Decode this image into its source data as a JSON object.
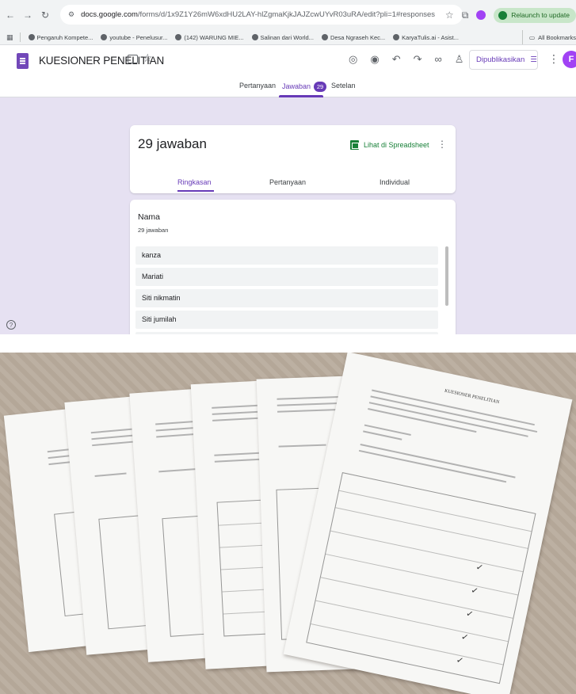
{
  "browser": {
    "url_host": "docs.google.com",
    "url_path": "/forms/d/1x9Z1Y26mW6xdHU2LAY-hlZgmaKjkJAJZcwUYvR03uRA/edit?pli=1#responses",
    "relaunch_label": "Relaunch to update",
    "bookmarks": [
      "Pengaruh Kompete...",
      "youtube - Penelusur...",
      "(142) WARUNG MIE...",
      "Salinan dari World...",
      "Desa Ngraseh Kec...",
      "KaryaTulis.ai - Asist..."
    ],
    "all_bookmarks_label": "All Bookmarks"
  },
  "form": {
    "title": "KUESIONER PENELITIAN",
    "publish_label": "Dipublikasikan",
    "avatar_letter": "F",
    "tabs": {
      "questions": "Pertanyaan",
      "responses": "Jawaban",
      "responses_count": "29",
      "settings": "Setelan"
    }
  },
  "summary": {
    "response_count_label": "29 jawaban",
    "sheet_link": "Lihat di Spreadsheet",
    "subtabs": [
      "Ringkasan",
      "Pertanyaan",
      "Individual"
    ]
  },
  "question": {
    "title": "Nama",
    "count": "29 jawaban",
    "answers": [
      "kanza",
      "Mariati",
      "Siti nikmatin",
      "Siti jumilah",
      "waqiah"
    ]
  },
  "photo": {
    "paper_heading": "KUESIONER PENELITIAN"
  },
  "colors": {
    "accent": "#673ab7",
    "content_bg": "#e6e1f2",
    "sheets_green": "#188038",
    "relaunch_bg": "#c8e6c9"
  },
  "icons": [
    "back-icon",
    "forward-icon",
    "reload-icon",
    "site-info-icon",
    "star-icon",
    "extensions-icon",
    "apps-icon",
    "folder-icon",
    "palette-icon",
    "preview-icon",
    "undo-icon",
    "redo-icon",
    "link-icon",
    "add-collaborator-icon",
    "settings-icon",
    "more-vert-icon",
    "spreadsheet-icon",
    "help-icon",
    "checkmark-icon"
  ]
}
